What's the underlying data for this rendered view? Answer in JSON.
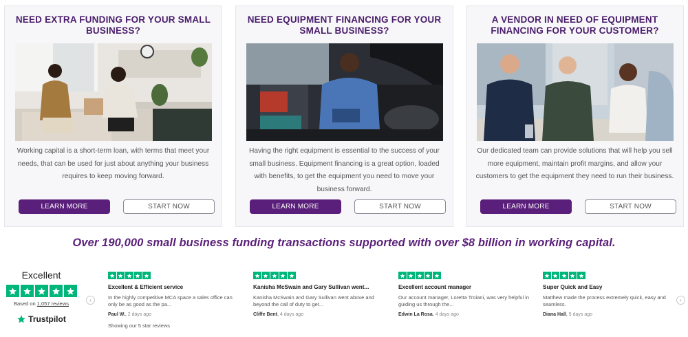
{
  "cards": [
    {
      "title": "NEED EXTRA FUNDING FOR YOUR SMALL BUSINESS?",
      "body": "Working capital is a short-term loan, with terms that meet your needs, that can be used for just about anything your business requires to keep moving forward.",
      "primary_label": "LEARN MORE",
      "secondary_label": "START NOW"
    },
    {
      "title": "NEED EQUIPMENT FINANCING FOR YOUR SMALL BUSINESS?",
      "body": "Having the right equipment is essential to the success of your small business. Equipment financing is a great option, loaded with benefits, to get the equipment you need to move your business forward.",
      "primary_label": "LEARN MORE",
      "secondary_label": "START NOW"
    },
    {
      "title": "A VENDOR IN NEED OF EQUIPMENT FINANCING FOR YOUR CUSTOMER?",
      "body": "Our dedicated team can provide solutions that will help you sell more equipment, maintain profit margins, and allow your customers to get the equipment they need to run their business.",
      "primary_label": "LEARN MORE",
      "secondary_label": "START NOW"
    }
  ],
  "banner": "Over 190,000 small business funding transactions supported with over $8 billion in working capital.",
  "trustpilot": {
    "rating_label": "Excellent",
    "stars": 5,
    "based_on_prefix": "Based on ",
    "review_count_link": "1,057 reviews",
    "logo_text": "Trustpilot",
    "showing_text": "Showing our 5 star reviews"
  },
  "reviews": [
    {
      "title": "Excellent & Efficient service",
      "text": "In the highly competitive MCA space a sales office can only be as good as the pa...",
      "author": "Paul W.",
      "date": "2 days ago",
      "stars": 5
    },
    {
      "title": "Kanisha McSwain and Gary Sullivan went...",
      "text": "Kanisha McSwain and Gary Sullivan went above and beyond the call of duty to get...",
      "author": "Cliffe Bent",
      "date": "4 days ago",
      "stars": 5
    },
    {
      "title": "Excellent account manager",
      "text": "Our account manager, Loretta Troiani, was very helpful in guiding us through the...",
      "author": "Edwin La Rosa",
      "date": "4 days ago",
      "stars": 5
    },
    {
      "title": "Super Quick and Easy",
      "text": "Matthew made the process extremely quick, easy and seamless.",
      "author": "Diana Hall",
      "date": "5 days ago",
      "stars": 5
    }
  ],
  "colors": {
    "brand_purple": "#5a1f7a",
    "title_purple": "#4a1d6b",
    "trustpilot_green": "#00b67a"
  }
}
